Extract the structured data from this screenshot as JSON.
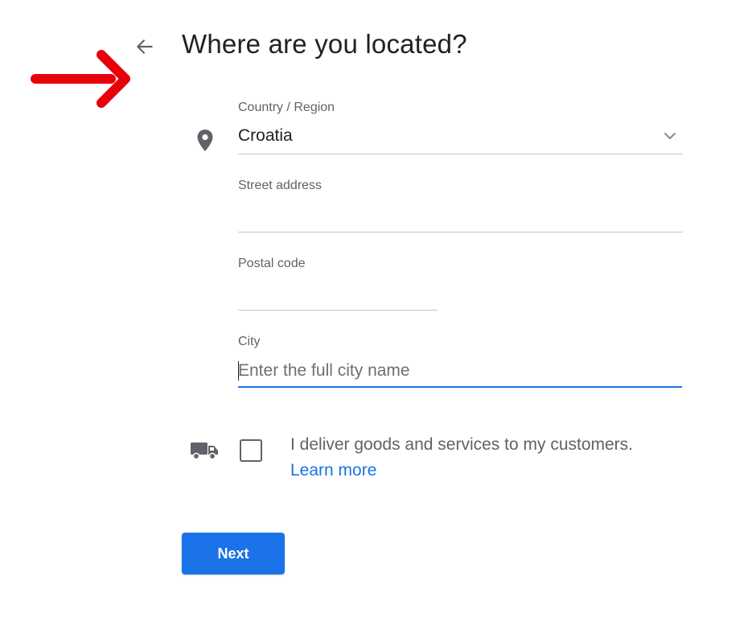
{
  "header": {
    "title": "Where are you located?",
    "back_icon": "arrow-left-icon"
  },
  "annotation": {
    "icon": "red-arrow-pointer",
    "color": "#e8000b"
  },
  "form": {
    "location_icon": "map-pin-icon",
    "country": {
      "label": "Country / Region",
      "value": "Croatia",
      "dropdown_icon": "chevron-down-icon"
    },
    "street": {
      "label": "Street address",
      "value": ""
    },
    "postal": {
      "label": "Postal code",
      "value": ""
    },
    "city": {
      "label": "City",
      "value": "",
      "placeholder": "Enter the full city name",
      "focused": true
    },
    "delivery": {
      "icon": "truck-icon",
      "checked": false,
      "text": "I deliver goods and services to my customers.",
      "link": "Learn more"
    }
  },
  "actions": {
    "next_label": "Next"
  },
  "colors": {
    "accent": "#1a73e8",
    "text": "#202124",
    "muted": "#5f6368",
    "annotation": "#e8000b"
  }
}
